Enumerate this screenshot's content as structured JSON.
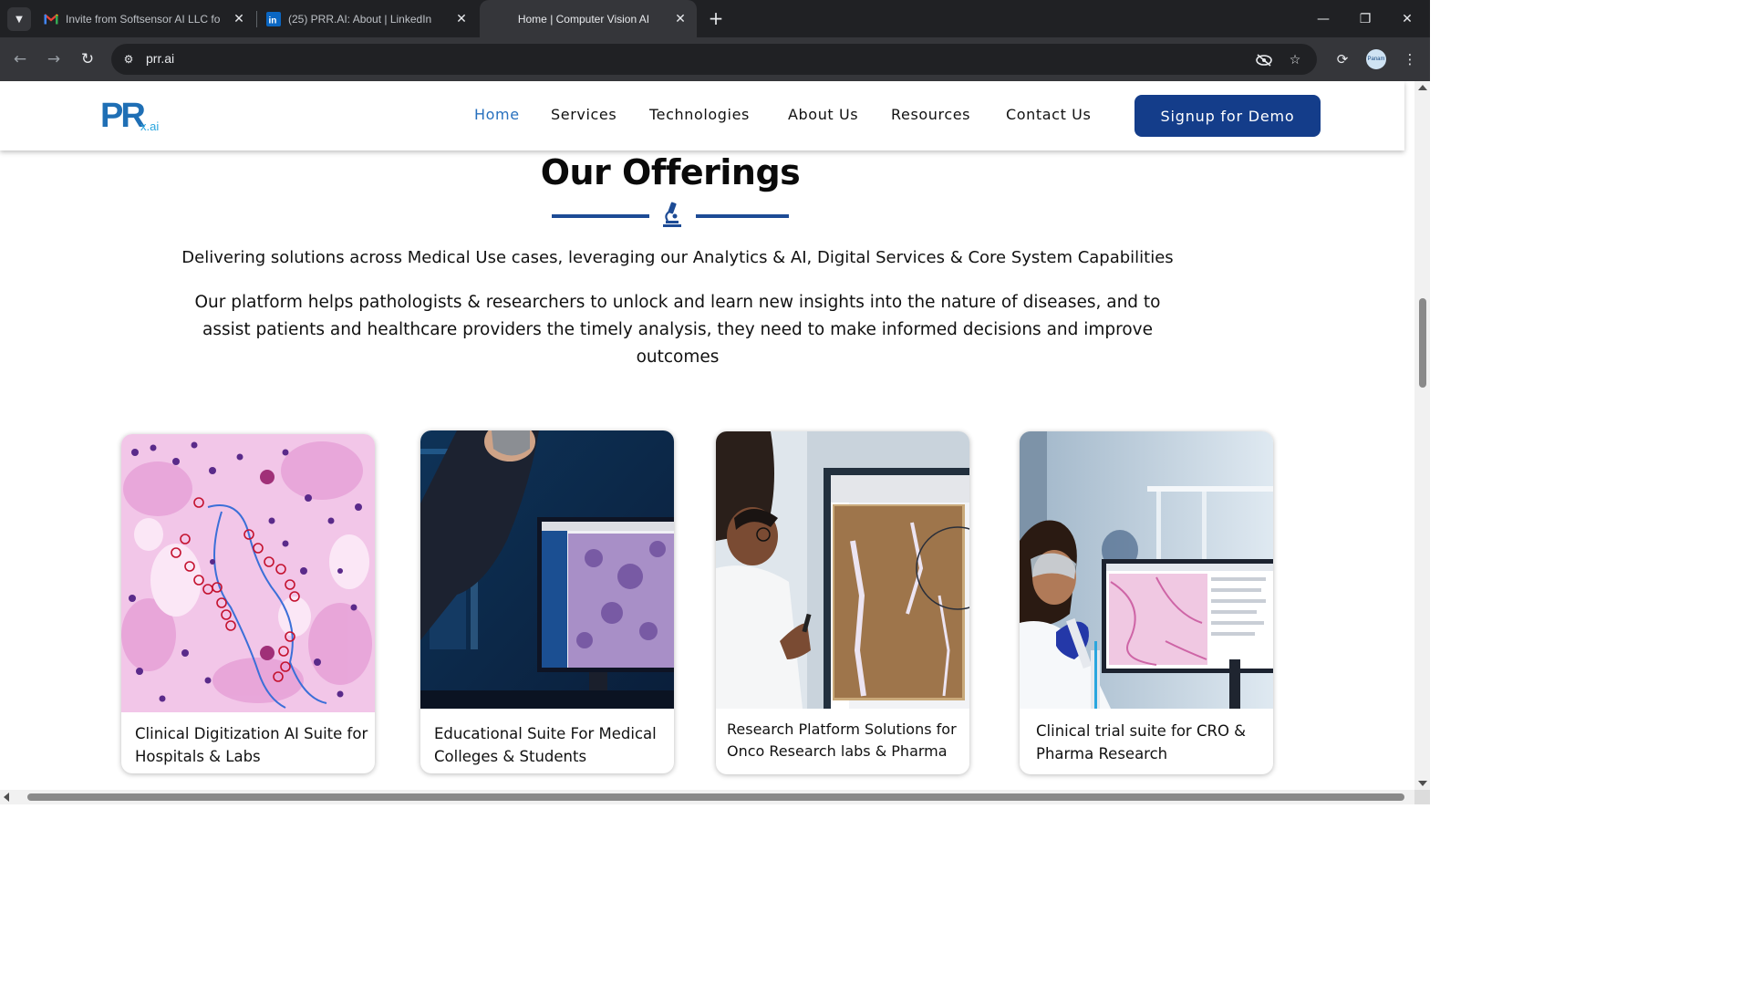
{
  "browser": {
    "tabs": [
      {
        "title": "Invite from Softsensor AI LLC fo",
        "icon": "gmail-icon",
        "active": false
      },
      {
        "title": "(25) PRR.AI: About | LinkedIn",
        "icon": "linkedin-icon",
        "active": false
      },
      {
        "title": "Home | Computer Vision AI",
        "icon": "",
        "active": true
      }
    ],
    "new_tab_label": "+",
    "url": "prr.ai",
    "profile_label": "Panam"
  },
  "site": {
    "logo_main": "PR",
    "logo_sub": "x.ai",
    "nav": [
      {
        "label": "Home",
        "active": true
      },
      {
        "label": "Services",
        "active": false
      },
      {
        "label": "Technologies",
        "active": false
      },
      {
        "label": "About Us",
        "active": false
      },
      {
        "label": "Resources",
        "active": false
      },
      {
        "label": "Contact Us",
        "active": false
      }
    ],
    "cta_label": "Signup for Demo",
    "accent_color": "#143d8a",
    "active_link_color": "#2770be"
  },
  "offerings": {
    "heading": "Our Offerings",
    "divider_icon": "microscope-icon",
    "lead": "Delivering solutions across Medical Use cases, leveraging our Analytics & AI, Digital Services & Core System Capabilities",
    "paragraph": "Our platform helps pathologists & researchers  to unlock and learn new insights into the nature of diseases, and to assist patients and healthcare providers the timely analysis, they need to make informed decisions and improve outcomes",
    "cards": [
      {
        "caption": "Clinical Digitization AI Suite for Hospitals & Labs",
        "image": "histology-slide-image"
      },
      {
        "caption": "Educational Suite For Medical Colleges & Students",
        "image": "scientist-monitor-image"
      },
      {
        "caption": "Research Platform Solutions for Onco Research labs & Pharma",
        "image": "researcher-touchscreen-image"
      },
      {
        "caption": "Clinical trial suite for CRO & Pharma Research",
        "image": "lab-pipette-image"
      }
    ]
  }
}
